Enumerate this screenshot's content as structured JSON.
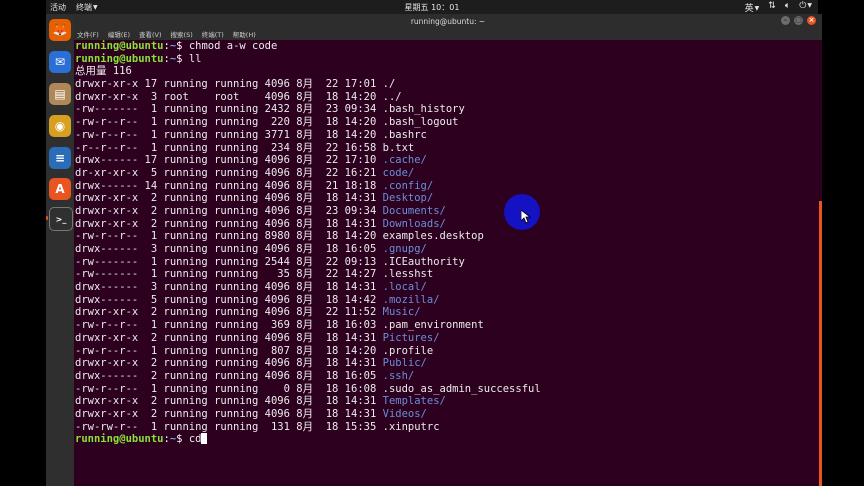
{
  "topbar": {
    "activities": "活动",
    "app_menu": "终端",
    "clock": "星期五 10：01",
    "input_method": "英",
    "icons": [
      "network-icon",
      "volume-icon",
      "power-icon"
    ]
  },
  "dock": {
    "apps": [
      {
        "name": "firefox-icon",
        "glyph": "🦊",
        "color": "#e66000"
      },
      {
        "name": "thunderbird-icon",
        "glyph": "✉",
        "color": "#2a6fd6"
      },
      {
        "name": "files-icon",
        "glyph": "▤",
        "color": "#b08858"
      },
      {
        "name": "rhythmbox-icon",
        "glyph": "◉",
        "color": "#d8a020"
      },
      {
        "name": "libreoffice-writer-icon",
        "glyph": "≡",
        "color": "#2a6cb8"
      },
      {
        "name": "software-center-icon",
        "glyph": "A",
        "color": "#e95420"
      },
      {
        "name": "terminal-icon",
        "glyph": ">_",
        "color": "#303030"
      }
    ]
  },
  "window": {
    "title": "running@ubuntu: ~",
    "menu": [
      "文件(F)",
      "编辑(E)",
      "查看(V)",
      "搜索(S)",
      "终端(T)",
      "帮助(H)"
    ]
  },
  "terminal": {
    "prompt_user": "running@ubuntu",
    "prompt_cwd": "~",
    "commands": [
      "chmod a-w code",
      "ll"
    ],
    "total": "总用量 116",
    "listing": [
      {
        "meta": "drwxr-xr-x 17 running running 4096 8月  22 17:01 ",
        "name": "./",
        "dir": false
      },
      {
        "meta": "drwxr-xr-x  3 root    root    4096 8月  18 14:20 ",
        "name": "../",
        "dir": false
      },
      {
        "meta": "-rw-------  1 running running 2432 8月  23 09:34 ",
        "name": ".bash_history",
        "dir": false
      },
      {
        "meta": "-rw-r--r--  1 running running  220 8月  18 14:20 ",
        "name": ".bash_logout",
        "dir": false
      },
      {
        "meta": "-rw-r--r--  1 running running 3771 8月  18 14:20 ",
        "name": ".bashrc",
        "dir": false
      },
      {
        "meta": "-r--r--r--  1 running running  234 8月  22 16:58 ",
        "name": "b.txt",
        "dir": false
      },
      {
        "meta": "drwx------ 17 running running 4096 8月  22 17:10 ",
        "name": ".cache/",
        "dir": true
      },
      {
        "meta": "dr-xr-xr-x  5 running running 4096 8月  22 16:21 ",
        "name": "code/",
        "dir": true
      },
      {
        "meta": "drwx------ 14 running running 4096 8月  21 18:18 ",
        "name": ".config/",
        "dir": true
      },
      {
        "meta": "drwxr-xr-x  2 running running 4096 8月  18 14:31 ",
        "name": "Desktop/",
        "dir": true
      },
      {
        "meta": "drwxr-xr-x  2 running running 4096 8月  23 09:34 ",
        "name": "Documents/",
        "dir": true
      },
      {
        "meta": "drwxr-xr-x  2 running running 4096 8月  18 14:31 ",
        "name": "Downloads/",
        "dir": true
      },
      {
        "meta": "-rw-r--r--  1 running running 8980 8月  18 14:20 ",
        "name": "examples.desktop",
        "dir": false
      },
      {
        "meta": "drwx------  3 running running 4096 8月  18 16:05 ",
        "name": ".gnupg/",
        "dir": true
      },
      {
        "meta": "-rw-------  1 running running 2544 8月  22 09:13 ",
        "name": ".ICEauthority",
        "dir": false
      },
      {
        "meta": "-rw-------  1 running running   35 8月  22 14:27 ",
        "name": ".lesshst",
        "dir": false
      },
      {
        "meta": "drwx------  3 running running 4096 8月  18 14:31 ",
        "name": ".local/",
        "dir": true
      },
      {
        "meta": "drwx------  5 running running 4096 8月  18 14:42 ",
        "name": ".mozilla/",
        "dir": true
      },
      {
        "meta": "drwxr-xr-x  2 running running 4096 8月  22 11:52 ",
        "name": "Music/",
        "dir": true
      },
      {
        "meta": "-rw-r--r--  1 running running  369 8月  18 16:03 ",
        "name": ".pam_environment",
        "dir": false
      },
      {
        "meta": "drwxr-xr-x  2 running running 4096 8月  18 14:31 ",
        "name": "Pictures/",
        "dir": true
      },
      {
        "meta": "-rw-r--r--  1 running running  807 8月  18 14:20 ",
        "name": ".profile",
        "dir": false
      },
      {
        "meta": "drwxr-xr-x  2 running running 4096 8月  18 14:31 ",
        "name": "Public/",
        "dir": true
      },
      {
        "meta": "drwx------  2 running running 4096 8月  18 16:05 ",
        "name": ".ssh/",
        "dir": true
      },
      {
        "meta": "-rw-r--r--  1 running running    0 8月  18 16:08 ",
        "name": ".sudo_as_admin_successful",
        "dir": false
      },
      {
        "meta": "drwxr-xr-x  2 running running 4096 8月  18 14:31 ",
        "name": "Templates/",
        "dir": true
      },
      {
        "meta": "drwxr-xr-x  2 running running 4096 8月  18 14:31 ",
        "name": "Videos/",
        "dir": true
      },
      {
        "meta": "-rw-rw-r--  1 running running  131 8月  18 15:35 ",
        "name": ".xinputrc",
        "dir": false
      }
    ],
    "current_input": "cd"
  },
  "colors": {
    "terminal_bg": "#2c001e",
    "prompt_green": "#8ae234",
    "dir_blue": "#6c8fd9",
    "accent_orange": "#e95420",
    "pointer_dot": "#1313cc"
  },
  "scrollbar": {
    "visible_fraction": 0.64,
    "position_fraction": 1.0
  }
}
